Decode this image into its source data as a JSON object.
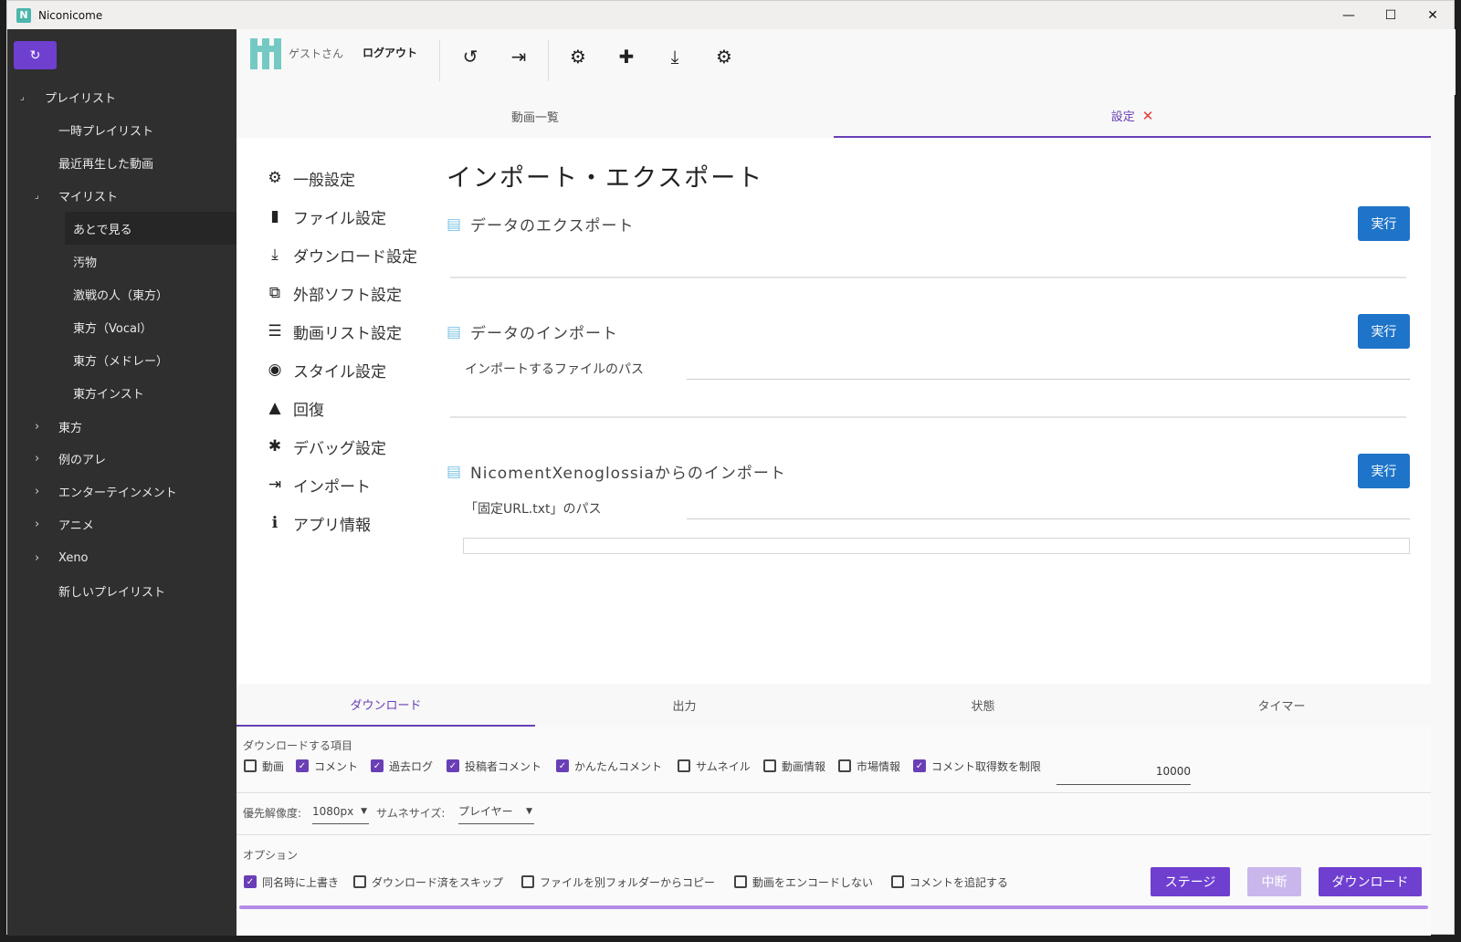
{
  "window": {
    "title": "Niconicome",
    "logo_letter": "N"
  },
  "sidebar": {
    "refresh_icon": "refresh-icon",
    "items": [
      {
        "label": "プレイリスト",
        "toggle": "⌟"
      },
      {
        "label": "一時プレイリスト"
      },
      {
        "label": "最近再生した動画"
      },
      {
        "label": "マイリスト",
        "toggle": "⌟"
      },
      {
        "label": "あとで見る"
      },
      {
        "label": "汚物"
      },
      {
        "label": "激戦の人（東方）"
      },
      {
        "label": "東方（Vocal）"
      },
      {
        "label": "東方（メドレー）"
      },
      {
        "label": "東方インスト"
      },
      {
        "label": "東方",
        "toggle": "›"
      },
      {
        "label": "例のアレ",
        "toggle": "›"
      },
      {
        "label": "エンターテインメント",
        "toggle": "›"
      },
      {
        "label": "アニメ",
        "toggle": "›"
      },
      {
        "label": "Xeno",
        "toggle": "›"
      },
      {
        "label": "新しいプレイリスト"
      }
    ]
  },
  "header": {
    "guest_name": "ゲストさん",
    "logout": "ログアウト"
  },
  "main_tabs": [
    {
      "label": "動画一覧"
    },
    {
      "label": "設定",
      "close": "✕"
    }
  ],
  "settings_menu": [
    {
      "label": "一般設定",
      "icon": "⚙"
    },
    {
      "label": "ファイル設定",
      "icon": "▮"
    },
    {
      "label": "ダウンロード設定",
      "icon": "⤓"
    },
    {
      "label": "外部ソフト設定",
      "icon": "⧉"
    },
    {
      "label": "動画リスト設定",
      "icon": "☰"
    },
    {
      "label": "スタイル設定",
      "icon": "◉"
    },
    {
      "label": "回復",
      "icon": "▲"
    },
    {
      "label": "デバッグ設定",
      "icon": "✱"
    },
    {
      "label": "インポート",
      "icon": "⇥"
    },
    {
      "label": "アプリ情報",
      "icon": "ℹ"
    }
  ],
  "page": {
    "heading": "インポート・エクスポート",
    "export": {
      "title": "データのエクスポート",
      "button": "実行"
    },
    "import": {
      "title": "データのインポート",
      "button": "実行",
      "field_label": "インポートするファイルのパス",
      "field_value": ""
    },
    "xeno": {
      "title": "NicomentXenoglossiaからのインポート",
      "button": "実行",
      "field_label": "「固定URL.txt」のパス",
      "field_value": ""
    }
  },
  "bottom_tabs": [
    {
      "label": "ダウンロード"
    },
    {
      "label": "出力"
    },
    {
      "label": "状態"
    },
    {
      "label": "タイマー"
    }
  ],
  "download": {
    "items_label": "ダウンロードする項目",
    "items": [
      {
        "label": "動画",
        "checked": false
      },
      {
        "label": "コメント",
        "checked": true
      },
      {
        "label": "過去ログ",
        "checked": true
      },
      {
        "label": "投稿者コメント",
        "checked": true
      },
      {
        "label": "かんたんコメント",
        "checked": true
      },
      {
        "label": "サムネイル",
        "checked": false
      },
      {
        "label": "動画情報",
        "checked": false
      },
      {
        "label": "市場情報",
        "checked": false
      },
      {
        "label": "コメント取得数を制限",
        "checked": true
      }
    ],
    "comment_limit": "10000",
    "resolution_label": "優先解像度:",
    "resolution_value": "1080px",
    "thumb_label": "サムネサイズ:",
    "thumb_value": "プレイヤー",
    "options_label": "オプション",
    "options": [
      {
        "label": "同名時に上書き",
        "checked": true
      },
      {
        "label": "ダウンロード済をスキップ",
        "checked": false
      },
      {
        "label": "ファイルを別フォルダーからコピー",
        "checked": false
      },
      {
        "label": "動画をエンコードしない",
        "checked": false
      },
      {
        "label": "コメントを追記する",
        "checked": false
      }
    ],
    "stage_button": "ステージ",
    "cancel_button": "中断",
    "download_button": "ダウンロード",
    "progress": 1.0
  },
  "colors": {
    "accent": "#6a3fb6",
    "button_blue": "#1e74c8",
    "sidebar_bg": "#2f2f2f"
  }
}
